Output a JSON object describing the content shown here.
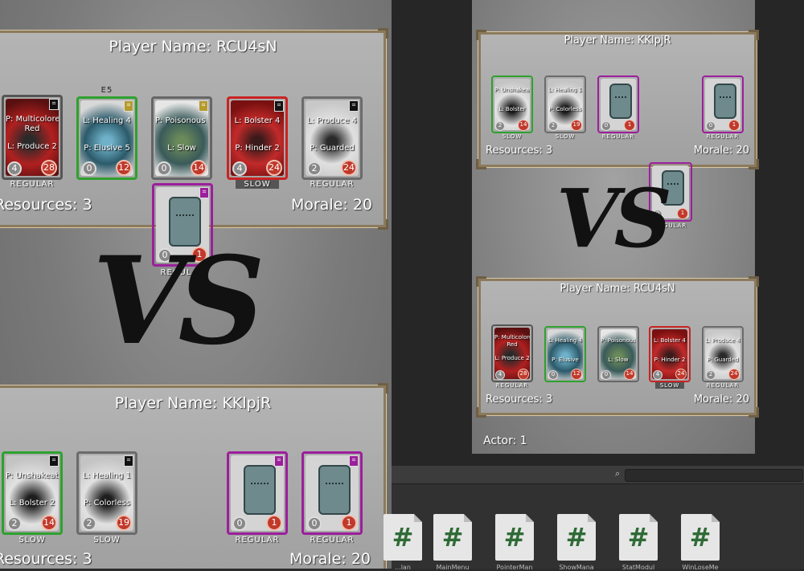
{
  "left_view": {
    "top_player": {
      "title": "Player Name: RCU4sN",
      "resources": "Resources: 3",
      "morale": "Morale: 20",
      "cards": [
        {
          "line1": "P: Multicolored",
          "line2": "Red",
          "line3": "L: Produce 2",
          "cost": "4",
          "morale": "28",
          "badge": "",
          "tag": "REGULAR"
        },
        {
          "line1": "L: Healing 4",
          "line2": "",
          "line3": "P: Elusive 5",
          "cost": "0",
          "morale": "12",
          "badge": "E5",
          "tag": ""
        },
        {
          "line1": "P: Poisonous 2",
          "line2": "",
          "line3": "L: Slow",
          "cost": "0",
          "morale": "14",
          "badge": "",
          "tag": ""
        },
        {
          "line1": "L: Bolster 4",
          "line2": "",
          "line3": "P: Hinder 2",
          "cost": "4",
          "morale": "24",
          "badge": "",
          "tag": "SLOW"
        },
        {
          "line1": "L: Produce 4",
          "line2": "",
          "line3": "P: Guarded",
          "cost": "2",
          "morale": "24",
          "badge": "",
          "tag": "REGULAR"
        }
      ]
    },
    "floating_card": {
      "cost": "0",
      "morale": "1",
      "tag": "REGULAR"
    },
    "vs": "VS",
    "bottom_player": {
      "title": "Player Name: KKlpjR",
      "resources": "Resources: 3",
      "morale": "Morale: 20",
      "cards": [
        {
          "line1": "P: Unshakeable",
          "line3": "L: Bolster 2",
          "cost": "2",
          "morale": "14",
          "tag": "SLOW"
        },
        {
          "line1": "L: Healing 1",
          "line3": "P: Colorless",
          "cost": "2",
          "morale": "19",
          "tag": "SLOW"
        },
        {
          "line1": "",
          "line3": "",
          "cost": "0",
          "morale": "1",
          "tag": "REGULAR"
        },
        {
          "line1": "",
          "line3": "",
          "cost": "0",
          "morale": "1",
          "tag": "REGULAR"
        }
      ]
    }
  },
  "right_view": {
    "top_player": {
      "title": "Player Name: KKlpjR",
      "resources": "Resources: 3",
      "morale": "Morale: 20",
      "cards": [
        {
          "line1": "P: Unshakeable",
          "line3": "L: Bolster",
          "cost": "2",
          "morale": "14",
          "tag": "SLOW"
        },
        {
          "line1": "L: Healing 1",
          "line3": "P: Colorless",
          "cost": "2",
          "morale": "19",
          "tag": "SLOW"
        },
        {
          "line1": "",
          "line3": "",
          "cost": "0",
          "morale": "1",
          "tag": "REGULAR"
        },
        {
          "line1": "",
          "line3": "",
          "cost": "0",
          "morale": "1",
          "tag": "REGULAR"
        }
      ]
    },
    "floating_card": {
      "cost": "0",
      "morale": "1",
      "tag": "REGULAR"
    },
    "vs": "VS",
    "bottom_player": {
      "title": "Player Name: RCU4sN",
      "resources": "Resources: 3",
      "morale": "Morale: 20",
      "cards": [
        {
          "line1": "P: Multicolored",
          "line2": "Red",
          "line3": "L: Produce 2",
          "cost": "4",
          "morale": "28",
          "tag": "REGULAR"
        },
        {
          "line1": "L: Healing 4",
          "line3": "P: Elusive",
          "cost": "0",
          "morale": "12",
          "tag": ""
        },
        {
          "line1": "P: Poisonous",
          "line3": "L: Slow",
          "cost": "0",
          "morale": "14",
          "tag": ""
        },
        {
          "line1": "L: Bolster 4",
          "line3": "P: Hinder 2",
          "cost": "4",
          "morale": "24",
          "tag": "SLOW"
        },
        {
          "line1": "L: Produce 4",
          "line3": "P: Guarded",
          "cost": "2",
          "morale": "24",
          "tag": "REGULAR"
        }
      ]
    },
    "actor": "Actor: 1"
  },
  "assets": [
    {
      "label": "...lan"
    },
    {
      "label": "MainMenu"
    },
    {
      "label": "PointerMan"
    },
    {
      "label": "ShowMana"
    },
    {
      "label": "StatModul"
    },
    {
      "label": "WinLoseMe"
    }
  ],
  "colors": {
    "panel_border": "#8b7a5c",
    "regular_frame": "#9b1f9b",
    "green_frame": "#2ea12e",
    "red_frame": "#c92323",
    "gray_frame": "#6b6b6b"
  }
}
